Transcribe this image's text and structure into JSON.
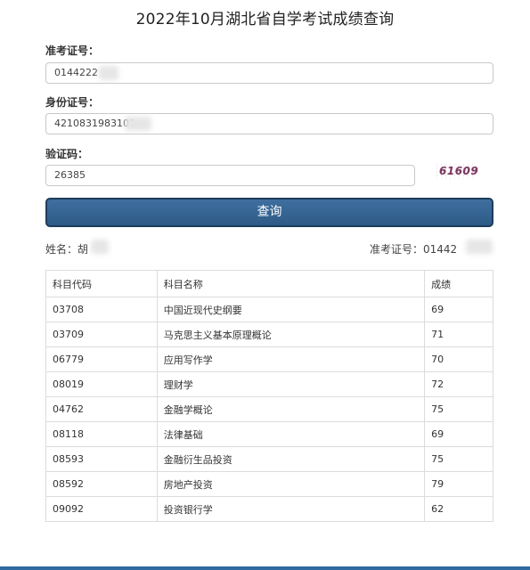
{
  "page": {
    "title": "2022年10月湖北省自学考试成绩查询"
  },
  "form": {
    "exam_id": {
      "label": "准考证号：",
      "value": "0144222"
    },
    "id_card": {
      "label": "身份证号：",
      "value": "4210831983101"
    },
    "captcha": {
      "label": "验证码：",
      "value": "26385",
      "image_text": "61609"
    },
    "query_button": "查询"
  },
  "result": {
    "name_label": "姓名：胡",
    "exam_id_label": "准考证号：01442"
  },
  "table": {
    "headers": [
      "科目代码",
      "科目名称",
      "成绩"
    ],
    "rows": [
      [
        "03708",
        "中国近现代史纲要",
        "69"
      ],
      [
        "03709",
        "马克思主义基本原理概论",
        "71"
      ],
      [
        "06779",
        "应用写作学",
        "70"
      ],
      [
        "08019",
        "理财学",
        "72"
      ],
      [
        "04762",
        "金融学概论",
        "75"
      ],
      [
        "08118",
        "法律基础",
        "69"
      ],
      [
        "08593",
        "金融衍生品投资",
        "75"
      ],
      [
        "08592",
        "房地产投资",
        "79"
      ],
      [
        "09092",
        "投资银行学",
        "62"
      ]
    ]
  }
}
